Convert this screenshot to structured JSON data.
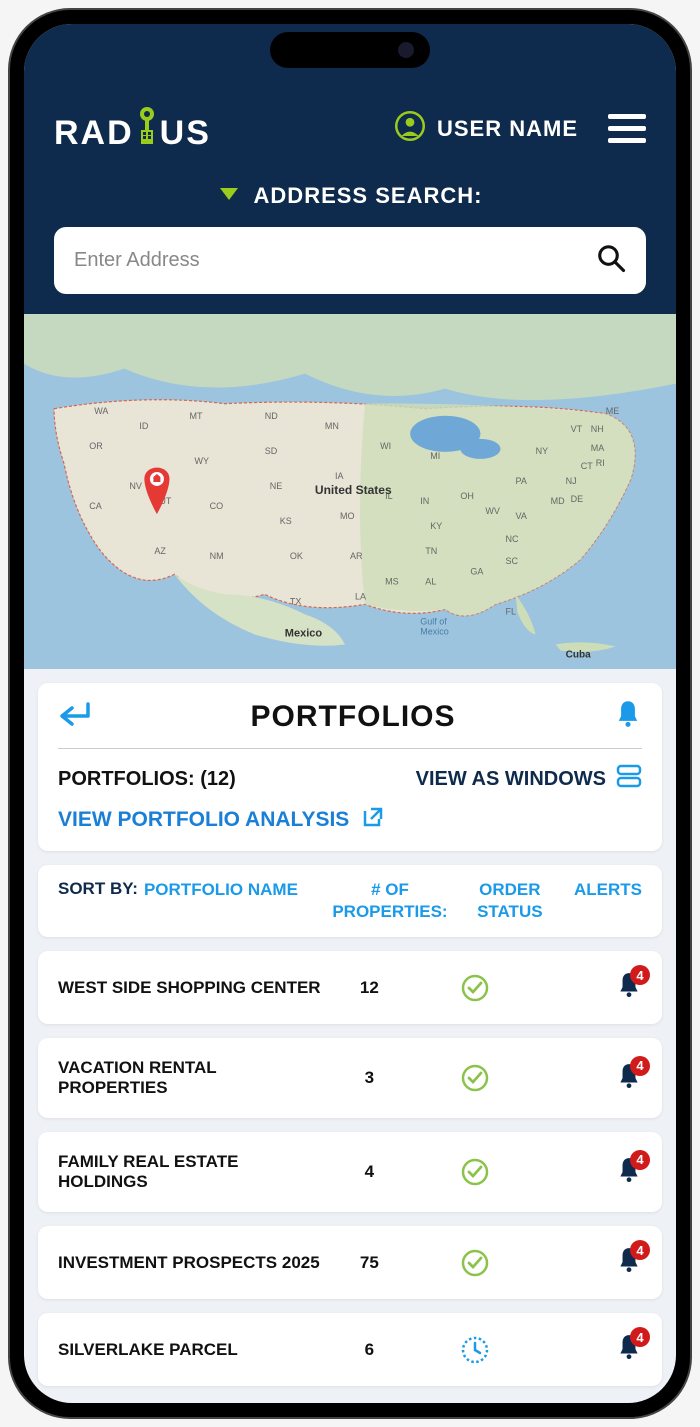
{
  "header": {
    "brand": "RADIUS",
    "user_label": "USER NAME",
    "search_label": "ADDRESS SEARCH:",
    "search_placeholder": "Enter Address"
  },
  "map": {
    "center_label": "United States",
    "mexico_label": "Mexico",
    "cuba_label": "Cuba",
    "gulf_label": "Gulf of Mexico",
    "states": [
      "WA",
      "OR",
      "CA",
      "NV",
      "ID",
      "MT",
      "WY",
      "UT",
      "AZ",
      "CO",
      "NM",
      "ND",
      "SD",
      "NE",
      "KS",
      "OK",
      "TX",
      "MN",
      "IA",
      "MO",
      "AR",
      "LA",
      "WI",
      "IL",
      "MS",
      "MI",
      "IN",
      "KY",
      "TN",
      "AL",
      "OH",
      "GA",
      "FL",
      "SC",
      "NC",
      "WV",
      "VA",
      "PA",
      "NY",
      "MD",
      "DE",
      "NJ",
      "CT",
      "RI",
      "MA",
      "VT",
      "NH",
      "ME"
    ]
  },
  "portfolios": {
    "title": "PORTFOLIOS",
    "count_label": "PORTFOLIOS: (12)",
    "view_windows": "VIEW AS WINDOWS",
    "view_analysis": "VIEW PORTFOLIO ANALYSIS"
  },
  "sort": {
    "label": "SORT BY:",
    "col_name": "PORTFOLIO NAME",
    "col_props": "# OF PROPERTIES:",
    "col_status": "ORDER STATUS",
    "col_alerts": "ALERTS"
  },
  "rows": [
    {
      "name": "WEST SIDE SHOPPING CENTER",
      "props": "12",
      "status": "ok",
      "alert_count": "4"
    },
    {
      "name": "VACATION RENTAL PROPERTIES",
      "props": "3",
      "status": "ok",
      "alert_count": "4"
    },
    {
      "name": "FAMILY REAL ESTATE HOLDINGS",
      "props": "4",
      "status": "ok",
      "alert_count": "4"
    },
    {
      "name": "INVESTMENT PROSPECTS 2025",
      "props": "75",
      "status": "ok",
      "alert_count": "4"
    },
    {
      "name": "SILVERLAKE PARCEL",
      "props": "6",
      "status": "pending",
      "alert_count": "4"
    }
  ],
  "colors": {
    "brand_green": "#9acc1e",
    "navy": "#0e2a4c",
    "blue": "#1a9ae8",
    "ok_green": "#8bc34a",
    "alert_red": "#d11b1b"
  }
}
